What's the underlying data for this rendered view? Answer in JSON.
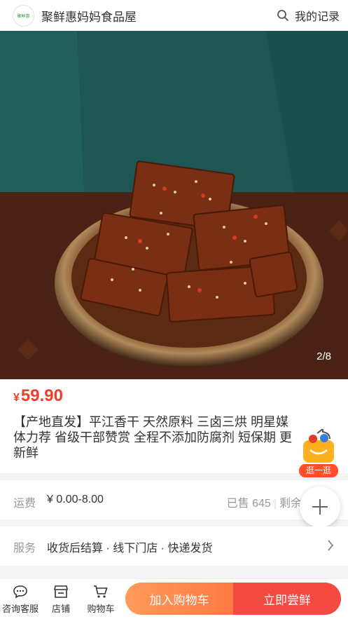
{
  "header": {
    "logo_text": "聚鲜惠",
    "store_name": "聚鲜惠妈妈食品屋",
    "records_label": "我的记录",
    "search_icon": "search-icon"
  },
  "gallery": {
    "page_indicator": "2/8",
    "current_page": 2,
    "total_pages": 8
  },
  "product": {
    "currency": "¥",
    "price": "59.90",
    "title": "【产地直发】平江香干 天然原料 三卤三烘 明星媒体力荐 省级干部赞赏 全程不添加防腐剂 短保期 更新鲜"
  },
  "share": {
    "label": "逛一逛"
  },
  "shipping": {
    "label": "运费",
    "value": "¥ 0.00-8.00",
    "sold": "已售 645",
    "stock": "剩余"
  },
  "service": {
    "label": "服务",
    "value": "收货后结算 · 线下门店 · 快递发货"
  },
  "bottom_bar": {
    "service_label": "咨询客服",
    "store_label": "店铺",
    "cart_label": "购物车",
    "add_cart_label": "加入购物车",
    "buy_label": "立即尝鲜"
  },
  "colors": {
    "price_red": "#f23c2a",
    "buy_red": "#f34a42",
    "cart_orange": "#ff8a50"
  }
}
